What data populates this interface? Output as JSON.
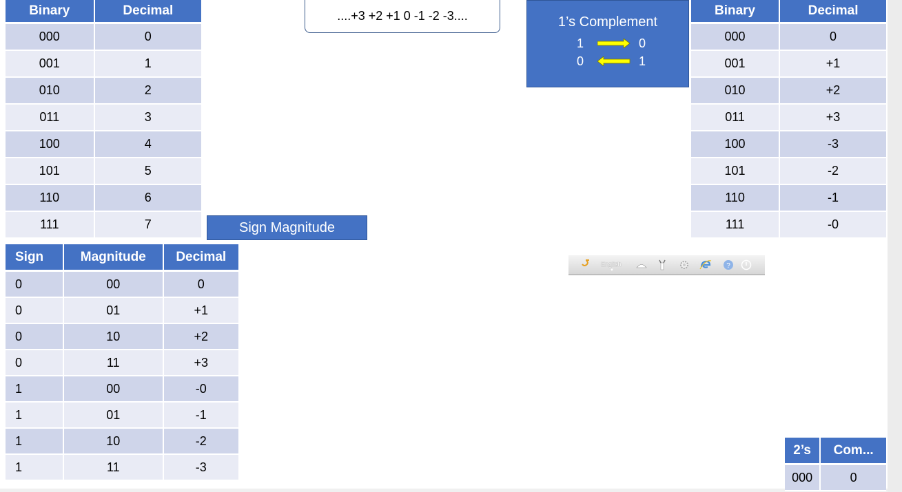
{
  "binary_table": {
    "headers": [
      "Binary",
      "Decimal"
    ],
    "rows": [
      [
        "000",
        "0"
      ],
      [
        "001",
        "1"
      ],
      [
        "010",
        "2"
      ],
      [
        "011",
        "3"
      ],
      [
        "100",
        "4"
      ],
      [
        "101",
        "5"
      ],
      [
        "110",
        "6"
      ],
      [
        "111",
        "7"
      ]
    ]
  },
  "number_line": {
    "text": "....+3 +2 +1 0  -1 -2 -3...."
  },
  "ones_complement_box": {
    "title": "1’s Complement",
    "row1": {
      "left": "1",
      "right": "0"
    },
    "row2": {
      "left": "0",
      "right": "1"
    },
    "arrow_color": "#ffff00"
  },
  "ones_table": {
    "headers": [
      "Binary",
      "Decimal"
    ],
    "rows": [
      [
        "000",
        "0"
      ],
      [
        "001",
        "+1"
      ],
      [
        "010",
        "+2"
      ],
      [
        "011",
        "+3"
      ],
      [
        "100",
        "-3"
      ],
      [
        "101",
        "-2"
      ],
      [
        "110",
        "-1"
      ],
      [
        "111",
        "-0"
      ]
    ]
  },
  "sign_magnitude_label": "Sign Magnitude",
  "sign_table": {
    "headers": [
      "Sign",
      "Magnitude",
      "Decimal"
    ],
    "rows": [
      [
        "0",
        "00",
        "0"
      ],
      [
        "0",
        "01",
        "+1"
      ],
      [
        "0",
        "10",
        "+2"
      ],
      [
        "0",
        "11",
        "+3"
      ],
      [
        "1",
        "00",
        "-0"
      ],
      [
        "1",
        "01",
        "-1"
      ],
      [
        "1",
        "10",
        "-2"
      ],
      [
        "1",
        "11",
        "-3"
      ]
    ]
  },
  "language_bar": {
    "language": "English",
    "icons": [
      "app-logo-icon",
      "caret-down-icon",
      "keyboard-icon",
      "tools-icon",
      "settings-icon",
      "browser-icon",
      "help-icon",
      "power-icon"
    ]
  },
  "twos_table": {
    "headers": [
      "2’s",
      "Com..."
    ],
    "rows": [
      [
        "000",
        "0"
      ]
    ]
  },
  "colors": {
    "accent": "#4472c4",
    "row_odd": "#cfd5ea",
    "row_even": "#e9ebf5"
  }
}
